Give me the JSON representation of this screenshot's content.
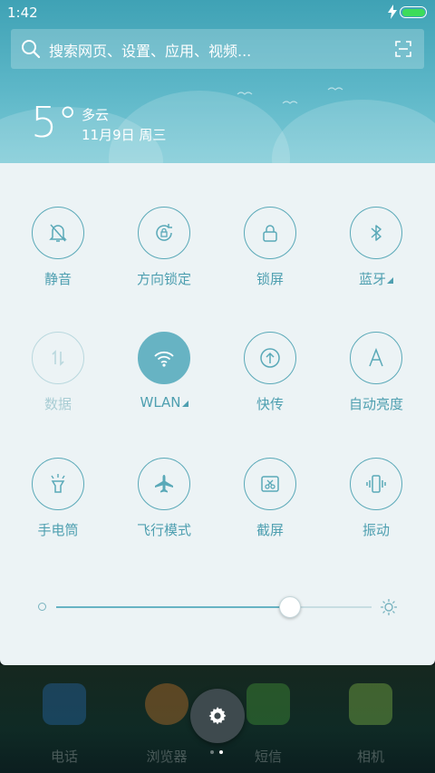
{
  "status_bar": {
    "time": "1:42",
    "battery_color": "#3ddc5a"
  },
  "search": {
    "placeholder": "搜索网页、设置、应用、视频..."
  },
  "weather": {
    "temperature": "5°",
    "condition": "多云",
    "date": "11月9日 周三"
  },
  "tiles": [
    {
      "label": "静音",
      "icon": "bell-off-icon"
    },
    {
      "label": "方向锁定",
      "icon": "rotation-lock-icon"
    },
    {
      "label": "锁屏",
      "icon": "lock-icon"
    },
    {
      "label": "蓝牙",
      "icon": "bluetooth-icon"
    },
    {
      "label": "数据",
      "icon": "data-arrows-icon"
    },
    {
      "label": "WLAN",
      "icon": "wifi-icon"
    },
    {
      "label": "快传",
      "icon": "upload-icon"
    },
    {
      "label": "自动亮度",
      "icon": "auto-brightness-icon"
    },
    {
      "label": "手电筒",
      "icon": "flashlight-icon"
    },
    {
      "label": "飞行模式",
      "icon": "airplane-icon"
    },
    {
      "label": "截屏",
      "icon": "screenshot-icon"
    },
    {
      "label": "振动",
      "icon": "vibrate-icon"
    }
  ],
  "brightness": {
    "level_percent": 74
  },
  "dock": [
    {
      "label": "电话",
      "icon": "phone-icon",
      "color": "#2a6fb8"
    },
    {
      "label": "浏览器",
      "icon": "browser-icon",
      "color": "#d27a2a"
    },
    {
      "label": "短信",
      "icon": "messages-icon",
      "color": "#4aa13a"
    },
    {
      "label": "相机",
      "icon": "camera-icon",
      "color": "#8bc34a"
    }
  ],
  "colors": {
    "accent": "#4e9fb0",
    "active_tile": "#67b3c3",
    "panel": "#ecf3f5"
  }
}
